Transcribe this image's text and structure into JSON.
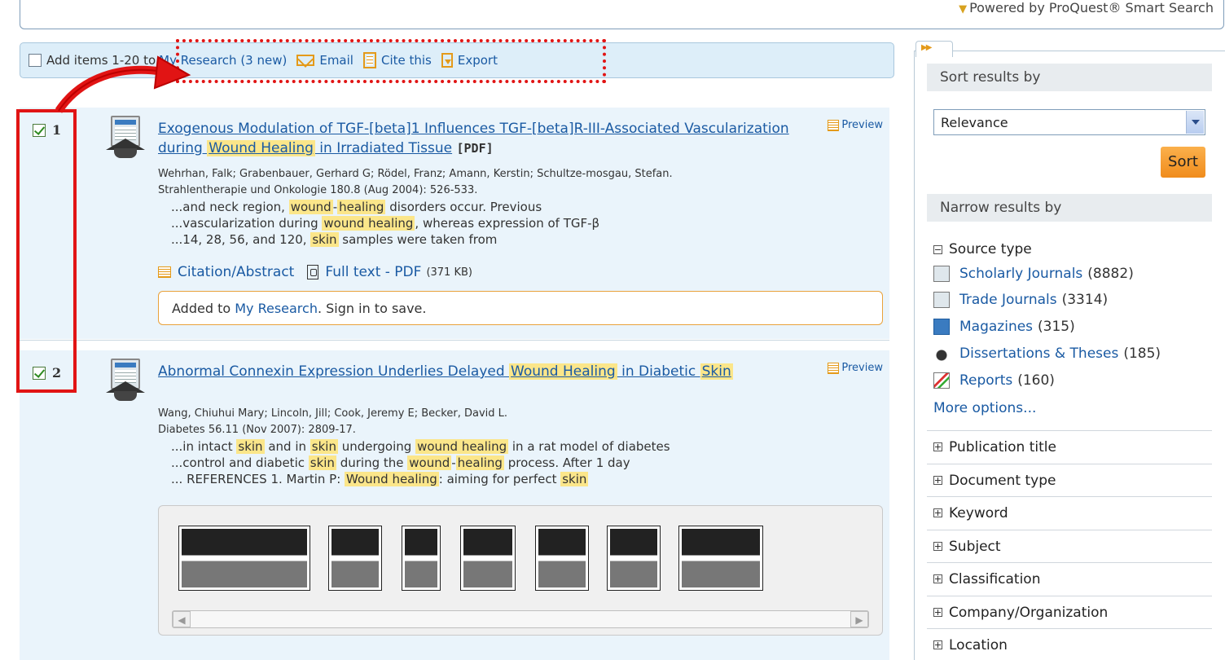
{
  "header": {
    "powered_by": "Powered by ProQuest® Smart Search"
  },
  "action_bar": {
    "add_label": "Add items 1-20 to",
    "my_research": "My Research (3 new)",
    "email": "Email",
    "cite": "Cite this",
    "export": "Export"
  },
  "results": [
    {
      "num": "1",
      "checked": true,
      "title_parts": [
        "Exogenous Modulation of TGF-[beta]1 Influences TGF-[beta]R-III-Associated Vascularization during ",
        "Wound Healing",
        " in Irradiated Tissue"
      ],
      "pdf_tag": "[PDF]",
      "preview": "Preview",
      "authors": "Wehrhan, Falk; Grabenbauer, Gerhard G; Rödel, Franz; Amann, Kerstin; Schultze-mosgau, Stefan.",
      "source": "Strahlentherapie und Onkologie 180.8 (Aug 2004): 526-533.",
      "snippets": [
        [
          "...and neck region, ",
          "wound",
          "-",
          "healing",
          " disorders occur. Previous"
        ],
        [
          "...vascularization during ",
          "wound healing",
          ", whereas expression of TGF-β"
        ],
        [
          "...14, 28, 56, and 120, ",
          "skin",
          " samples were taken from"
        ]
      ],
      "links": {
        "citation": "Citation/Abstract",
        "fulltext": "Full text - PDF",
        "size": "(371 KB)"
      },
      "added": {
        "prefix": "Added to ",
        "link": "My Research",
        "suffix": ". Sign in to save."
      }
    },
    {
      "num": "2",
      "checked": true,
      "title_parts": [
        "Abnormal Connexin Expression Underlies Delayed ",
        "Wound Healing",
        " in Diabetic ",
        "Skin"
      ],
      "preview": "Preview",
      "authors": "Wang, Chiuhui Mary; Lincoln, Jill; Cook, Jeremy E; Becker, David L.",
      "source": "Diabetes 56.11 (Nov 2007): 2809-17.",
      "snippets": [
        [
          "...in intact ",
          "skin",
          " and in ",
          "skin",
          " undergoing ",
          "wound healing",
          " in a rat model of diabetes"
        ],
        [
          "...control and diabetic ",
          "skin",
          " during the ",
          "wound",
          "-",
          "healing",
          " process. After 1 day"
        ],
        [
          "... REFERENCES 1. Martin P: ",
          "Wound healing",
          ": aiming for perfect ",
          "skin"
        ]
      ]
    }
  ],
  "sidebar": {
    "sort_header": "Sort results by",
    "sort_value": "Relevance",
    "sort_button": "Sort",
    "narrow_header": "Narrow results by",
    "source_type_label": "Source type",
    "source_types": [
      {
        "label": "Scholarly Journals",
        "count": "(8882)",
        "icon": "scholarly-journal-icon"
      },
      {
        "label": "Trade Journals",
        "count": "(3314)",
        "icon": "trade-journal-icon"
      },
      {
        "label": "Magazines",
        "count": "(315)",
        "icon": "magazine-icon"
      },
      {
        "label": "Dissertations & Theses",
        "count": "(185)",
        "icon": "dissertation-icon"
      },
      {
        "label": "Reports",
        "count": "(160)",
        "icon": "report-icon"
      }
    ],
    "more_options": "More options...",
    "facets": [
      "Publication title",
      "Document type",
      "Keyword",
      "Subject",
      "Classification",
      "Company/Organization",
      "Location"
    ]
  },
  "colors": {
    "accent": "#1a5aa3",
    "highlight": "#fbe68a",
    "annotation_red": "#e11414",
    "result_bg": "#eaf4fb"
  }
}
